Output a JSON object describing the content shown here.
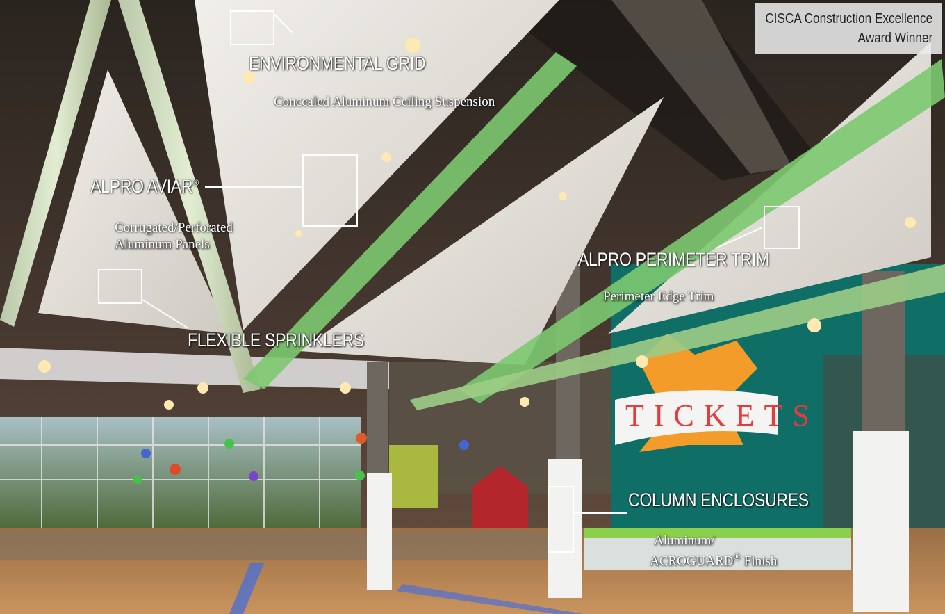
{
  "award": {
    "line1": "CISCA Construction Excellence",
    "line2": "Award Winner"
  },
  "callouts": {
    "environmental_grid": {
      "title": "ENVIRONMENTAL GRID",
      "subtitle": "Concealed Aluminum Ceiling Suspension"
    },
    "alpro_aviar": {
      "title": "ALPRO AVIAR",
      "mark": "®",
      "subtitle_line1": "Corrugated/Perforated",
      "subtitle_line2": "Aluminum Panels"
    },
    "flexible_sprinklers": {
      "title": "FLEXIBLE SPRINKLERS"
    },
    "perimeter_trim": {
      "title": "ALPRO  PERIMETER TRIM",
      "subtitle": "Perimeter Edge Trim"
    },
    "column_enclosures": {
      "title": "COLUMN ENCLOSURES",
      "subtitle_line1": "Aluminum/",
      "subtitle_line2_a": "ACROGUARD",
      "subtitle_mark": "®",
      "subtitle_line2_b": " Finish"
    }
  },
  "sign": {
    "text": "TICKETS"
  },
  "colors": {
    "teal_wall": "#0f6e66",
    "green_tube": "#4fd36a",
    "panel": "#e8e6e1"
  }
}
